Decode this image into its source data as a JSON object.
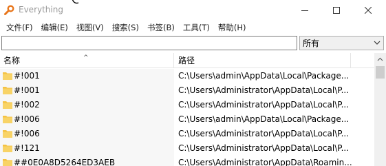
{
  "window": {
    "title": "Everything",
    "icon": "magnifier-app-icon"
  },
  "menu": [
    {
      "label": "文件(F)"
    },
    {
      "label": "编辑(E)"
    },
    {
      "label": "视图(V)"
    },
    {
      "label": "搜索(S)"
    },
    {
      "label": "书签(B)"
    },
    {
      "label": "工具(T)"
    },
    {
      "label": "帮助(H)"
    }
  ],
  "search": {
    "value": "",
    "placeholder": ""
  },
  "filter": {
    "selected": "所有"
  },
  "columns": {
    "name": "名称",
    "path": "路径"
  },
  "rows": [
    {
      "name": "#!001",
      "path": "C:\\Users\\admin\\AppData\\Local\\Package..."
    },
    {
      "name": "#!001",
      "path": "C:\\Users\\Administrator\\AppData\\Local\\P..."
    },
    {
      "name": "#!002",
      "path": "C:\\Users\\Administrator\\AppData\\Local\\P..."
    },
    {
      "name": "#!006",
      "path": "C:\\Users\\admin\\AppData\\Local\\Package..."
    },
    {
      "name": "#!006",
      "path": "C:\\Users\\Administrator\\AppData\\Local\\P..."
    },
    {
      "name": "#!121",
      "path": "C:\\Users\\Administrator\\AppData\\Local\\P..."
    },
    {
      "name": "##0E0A8D5264ED3AEB",
      "path": "C:\\Users\\Administrator\\AppData\\Roamin..."
    }
  ],
  "colors": {
    "folder": "#f5c242",
    "name_column_bg": "#f7f7f7",
    "title_text": "#9a9a9a",
    "app_icon": "#e8761c"
  }
}
